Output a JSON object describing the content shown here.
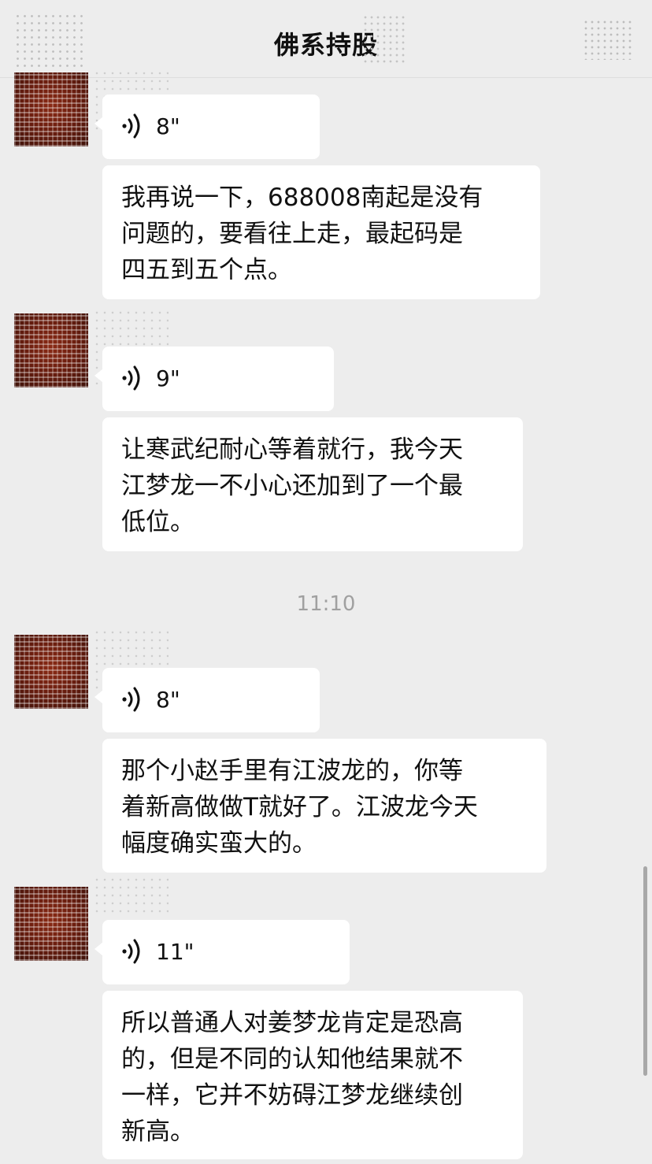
{
  "header": {
    "title": "佛系持股"
  },
  "messages": [
    {
      "type": "voice",
      "duration": "8\""
    },
    {
      "type": "text",
      "text": "我再说一下，688008南起是没有\n问题的，要看往上走，最起码是\n四五到五个点。"
    },
    {
      "type": "voice",
      "duration": "9\""
    },
    {
      "type": "text",
      "text": "让寒武纪耐心等着就行，我今天\n江梦龙一不小心还加到了一个最\n低位。"
    },
    {
      "type": "timestamp",
      "text": "11:10"
    },
    {
      "type": "voice",
      "duration": "8\""
    },
    {
      "type": "text",
      "text": "那个小赵手里有江波龙的，你等\n着新高做做T就好了。江波龙今天\n幅度确实蛮大的。"
    },
    {
      "type": "voice",
      "duration": "11\""
    },
    {
      "type": "text",
      "text": "所以普通人对姜梦龙肯定是恐高\n的，但是不同的认知他结果就不\n一样，它并不妨碍江梦龙继续创\n新高。"
    }
  ],
  "colors": {
    "background": "#ededed",
    "bubble": "#ffffff",
    "avatar": "#7a2412",
    "timestamp": "#a0a0a0"
  },
  "icons": {
    "back": "back-arrow-icon",
    "more": "more-icon",
    "voice": "voice-wave-icon"
  }
}
